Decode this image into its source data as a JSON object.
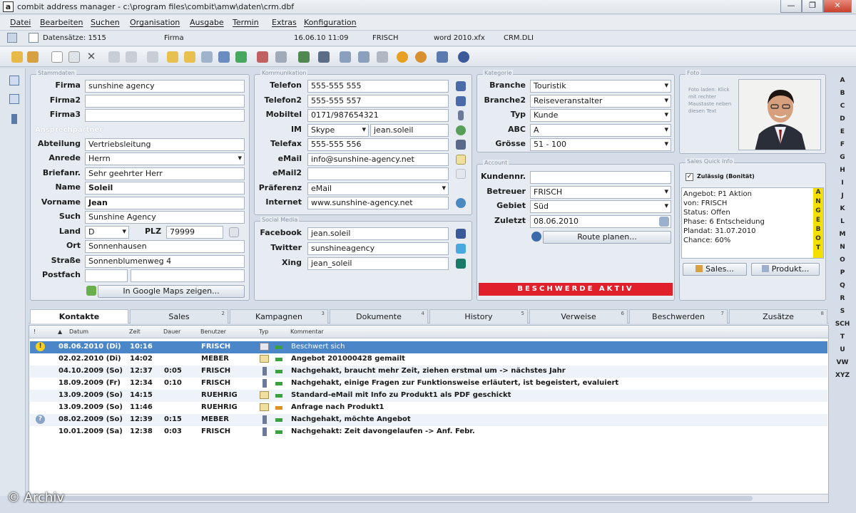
{
  "window": {
    "title": "combit address manager - c:\\program files\\combit\\amw\\daten\\crm.dbf",
    "app_icon": "a",
    "min": "—",
    "max": "❐",
    "close": "✕"
  },
  "menu": [
    "Datei",
    "Bearbeiten",
    "Suchen",
    "Organisation",
    "Ausgabe",
    "Termin",
    "Extras",
    "Konfiguration"
  ],
  "status": {
    "records": "Datensätze: 1515",
    "field": "Firma",
    "datetime": "16.06.10  11:09",
    "user": "FRISCH",
    "word": "word 2010.xfx",
    "layout": "CRM.DLI"
  },
  "stammdaten": {
    "legend": "Stammdaten",
    "firma_label": "Firma",
    "firma": "sunshine agency",
    "firma2_label": "Firma2",
    "firma2": "",
    "firma3_label": "Firma3",
    "firma3": "",
    "ansprech_label": "Ansprechpartner",
    "abteilung_label": "Abteilung",
    "abteilung": "Vertriebsleitung",
    "anrede_label": "Anrede",
    "anrede": "Herrn",
    "briefanr_label": "Briefanr.",
    "briefanr": "Sehr geehrter Herr",
    "name_label": "Name",
    "name": "Soleil",
    "vorname_label": "Vorname",
    "vorname": "Jean",
    "such_label": "Such",
    "such": "Sunshine Agency",
    "land_label": "Land",
    "land": "D",
    "plz_label": "PLZ",
    "plz": "79999",
    "ort_label": "Ort",
    "ort": "Sonnenhausen",
    "strasse_label": "Straße",
    "strasse": "Sonnenblumenweg 4",
    "postfach_label": "Postfach",
    "postfach": "",
    "maps_button": "In Google Maps zeigen..."
  },
  "kommunikation": {
    "legend": "Kommunikation",
    "telefon_label": "Telefon",
    "telefon": "555-555 555",
    "telefon2_label": "Telefon2",
    "telefon2": "555-555 557",
    "mobiltel_label": "Mobiltel",
    "mobiltel": "0171/987654321",
    "im_label": "IM",
    "im_type": "Skype",
    "im": "jean.soleil",
    "telefax_label": "Telefax",
    "telefax": "555-555 556",
    "email_label": "eMail",
    "email": "info@sunshine-agency.net",
    "email2_label": "eMail2",
    "email2": "",
    "praeferenz_label": "Präferenz",
    "praeferenz": "eMail",
    "internet_label": "Internet",
    "internet": "www.sunshine-agency.net"
  },
  "social": {
    "legend": "Social Media",
    "facebook_label": "Facebook",
    "facebook": "jean.soleil",
    "twitter_label": "Twitter",
    "twitter": "sunshineagency",
    "xing_label": "Xing",
    "xing": "jean_soleil"
  },
  "kategorie": {
    "legend": "Kategorie",
    "branche_label": "Branche",
    "branche": "Touristik",
    "branche2_label": "Branche2",
    "branche2": "Reiseveranstalter",
    "typ_label": "Typ",
    "typ": "Kunde",
    "abc_label": "ABC",
    "abc": "A",
    "groesse_label": "Grösse",
    "groesse": "51 - 100"
  },
  "account": {
    "legend": "Account",
    "kundennr_label": "Kundennr.",
    "kundennr": "",
    "betreuer_label": "Betreuer",
    "betreuer": "FRISCH",
    "gebiet_label": "Gebiet",
    "gebiet": "Süd",
    "zuletzt_label": "Zuletzt",
    "zuletzt": "08.06.2010",
    "route_button": "Route planen...",
    "banner": "BESCHWERDE AKTIV",
    "banner_color": "#e0202a"
  },
  "foto": {
    "legend": "Foto",
    "hint": "Foto laden: Klick mit rechter Maustaste neben diesen Text"
  },
  "quickinfo": {
    "legend": "Sales Quick Info",
    "checkbox": "Zulässig (Bonität)",
    "lines": [
      "Angebot: P1 Aktion",
      "von: FRISCH",
      "Status: Offen",
      "Phase: 6 Entscheidung",
      "Plandat: 31.07.2010",
      "Chance: 60%"
    ],
    "vertical": [
      "A",
      "N",
      "G",
      "E",
      "B",
      "O",
      "T"
    ],
    "sales_button": "Sales...",
    "produkt_button": "Produkt..."
  },
  "alphabet": [
    "A",
    "B",
    "C",
    "D",
    "E",
    "F",
    "G",
    "H",
    "I",
    "J",
    "K",
    "L",
    "M",
    "N",
    "O",
    "P",
    "Q",
    "R",
    "S",
    "SCH",
    "T",
    "U",
    "VW",
    "XYZ"
  ],
  "tabs": [
    {
      "label": "Kontakte",
      "num": ""
    },
    {
      "label": "Sales",
      "num": "2"
    },
    {
      "label": "Kampagnen",
      "num": "3"
    },
    {
      "label": "Dokumente",
      "num": "4"
    },
    {
      "label": "History",
      "num": "5"
    },
    {
      "label": "Verweise",
      "num": "6"
    },
    {
      "label": "Beschwerden",
      "num": "7"
    },
    {
      "label": "Zusätze",
      "num": "8"
    }
  ],
  "grid": {
    "headers": [
      "!",
      "Datum",
      "Zeit",
      "Dauer",
      "Benutzer",
      "Typ",
      "Kommentar"
    ],
    "rows": [
      {
        "flag": "!",
        "datum": "08.06.2010 (Di)",
        "zeit": "10:16",
        "dauer": "",
        "benutzer": "FRISCH",
        "kommentar": "Beschwert sich"
      },
      {
        "flag": "",
        "datum": "02.02.2010 (Di)",
        "zeit": "14:02",
        "dauer": "",
        "benutzer": "MEBER",
        "kommentar": "Angebot 201000428 gemailt"
      },
      {
        "flag": "",
        "datum": "04.10.2009 (So)",
        "zeit": "12:37",
        "dauer": "0:05",
        "benutzer": "FRISCH",
        "kommentar": "Nachgehakt, braucht mehr Zeit, ziehen erstmal um -> nächstes Jahr"
      },
      {
        "flag": "",
        "datum": "18.09.2009 (Fr)",
        "zeit": "12:34",
        "dauer": "0:10",
        "benutzer": "FRISCH",
        "kommentar": "Nachgehakt, einige Fragen zur Funktionsweise erläutert, ist begeistert, evaluiert"
      },
      {
        "flag": "",
        "datum": "13.09.2009 (So)",
        "zeit": "14:15",
        "dauer": "",
        "benutzer": "RUEHRIG",
        "kommentar": "Standard-eMail mit Info zu Produkt1 als PDF geschickt"
      },
      {
        "flag": "",
        "datum": "13.09.2009 (So)",
        "zeit": "11:46",
        "dauer": "",
        "benutzer": "RUEHRIG",
        "kommentar": "Anfrage nach Produkt1"
      },
      {
        "flag": "?",
        "datum": "08.02.2009 (So)",
        "zeit": "12:39",
        "dauer": "0:15",
        "benutzer": "MEBER",
        "kommentar": "Nachgehakt, möchte Angebot"
      },
      {
        "flag": "",
        "datum": "10.01.2009 (Sa)",
        "zeit": "12:38",
        "dauer": "0:03",
        "benutzer": "FRISCH",
        "kommentar": "Nachgehakt: Zeit davongelaufen -> Anf. Febr."
      }
    ]
  },
  "watermark": "© Archiv"
}
